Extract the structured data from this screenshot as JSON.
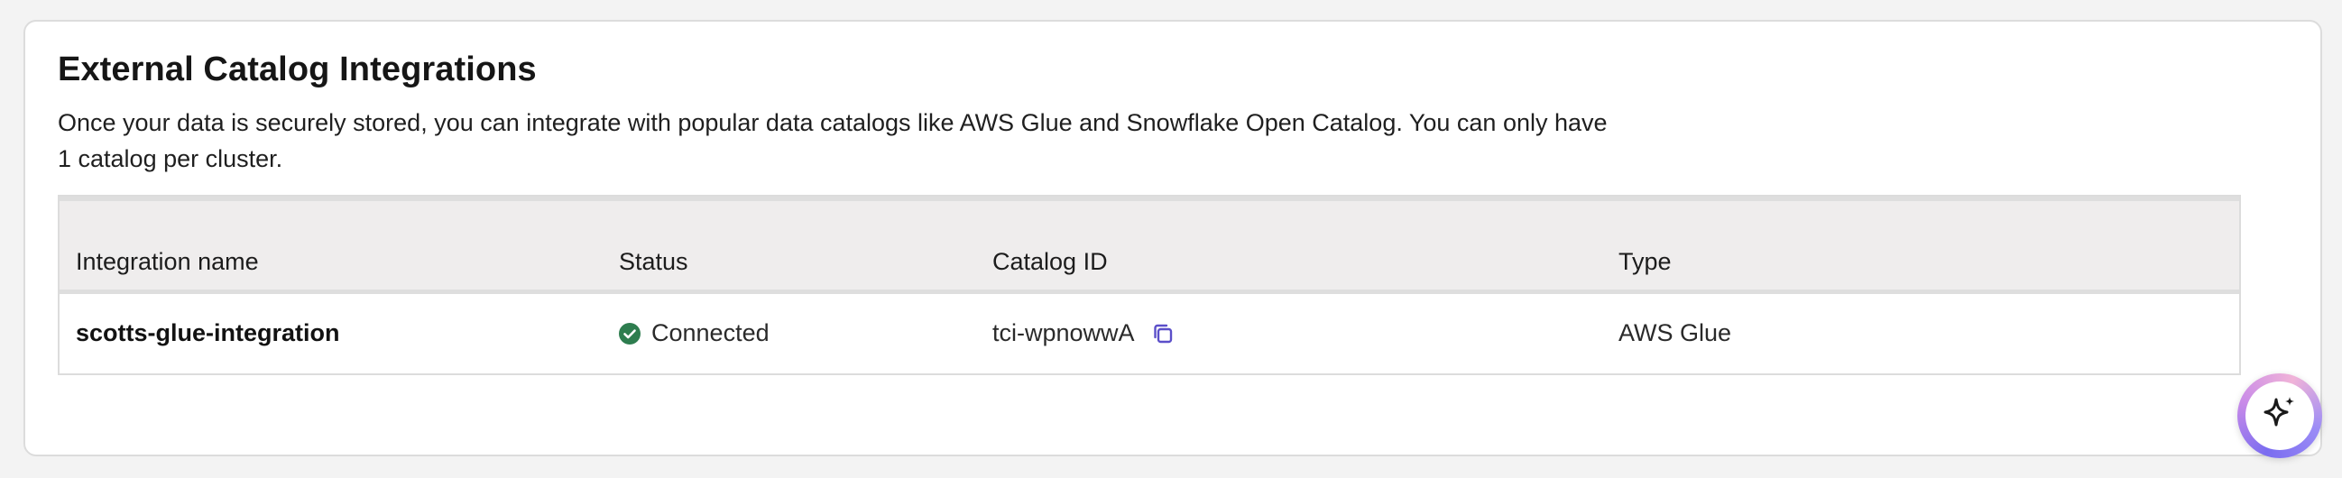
{
  "section": {
    "title": "External Catalog Integrations",
    "description": "Once your data is securely stored, you can integrate with popular data catalogs like AWS Glue and Snowflake Open Catalog. You can only have 1 catalog per cluster."
  },
  "table": {
    "columns": [
      "Integration name",
      "Status",
      "Catalog ID",
      "Type"
    ],
    "rows": [
      {
        "name": "scotts-glue-integration",
        "status": "Connected",
        "status_icon": "check-circle-icon",
        "catalog_id": "tci-wpnowwA",
        "catalog_icon": "copy-icon",
        "type": "AWS Glue"
      }
    ]
  },
  "assistant": {
    "icon": "sparkle-icon"
  },
  "colors": {
    "status_success": "#2e7d4f",
    "copy_icon": "#5b4fc9",
    "header_bg": "#efeded"
  }
}
